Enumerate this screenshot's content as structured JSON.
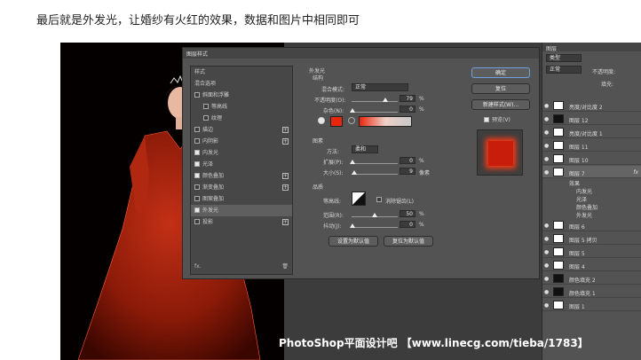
{
  "caption": "最后就是外发光，让婚纱有火红的效果，数据和图片中相同即可",
  "watermark": "PhotoShop平面设计吧 【www.linecg.com/tieba/1783】",
  "dialog": {
    "title": "图层样式",
    "left_items": [
      {
        "label": "样式",
        "has_checkbox": false,
        "checked": false,
        "has_plus": false
      },
      {
        "label": "混合选项",
        "has_checkbox": false,
        "checked": false,
        "has_plus": false
      },
      {
        "label": "斜面和浮雕",
        "has_checkbox": true,
        "checked": false,
        "has_plus": false
      },
      {
        "label": "等高线",
        "has_checkbox": true,
        "checked": false,
        "has_plus": false
      },
      {
        "label": "纹理",
        "has_checkbox": true,
        "checked": false,
        "has_plus": false
      },
      {
        "label": "描边",
        "has_checkbox": true,
        "checked": false,
        "has_plus": true
      },
      {
        "label": "内阴影",
        "has_checkbox": true,
        "checked": false,
        "has_plus": true
      },
      {
        "label": "内发光",
        "has_checkbox": true,
        "checked": true,
        "has_plus": false
      },
      {
        "label": "光泽",
        "has_checkbox": true,
        "checked": true,
        "has_plus": false
      },
      {
        "label": "颜色叠加",
        "has_checkbox": true,
        "checked": true,
        "has_plus": true
      },
      {
        "label": "渐变叠加",
        "has_checkbox": true,
        "checked": false,
        "has_plus": true
      },
      {
        "label": "图案叠加",
        "has_checkbox": true,
        "checked": false,
        "has_plus": false
      },
      {
        "label": "外发光",
        "has_checkbox": true,
        "checked": true,
        "has_plus": false,
        "selected": true
      },
      {
        "label": "投影",
        "has_checkbox": true,
        "checked": false,
        "has_plus": true
      }
    ],
    "footer_fx": "fx.",
    "outer_glow": {
      "header": "外发光",
      "structure": "结构",
      "blend_mode_label": "混合模式:",
      "blend_mode_value": "正常",
      "opacity_label": "不透明度(O):",
      "opacity_value": "79",
      "noise_label": "杂色(N):",
      "noise_value": "0",
      "percent": "%",
      "elements": "图素",
      "method_label": "方法:",
      "method_value": "柔和",
      "spread_label": "扩展(P):",
      "spread_value": "0",
      "size_label": "大小(S):",
      "size_value": "9",
      "pixels": "像素",
      "quality": "品质",
      "contour_label": "等高线:",
      "antialias_label": "消除锯齿(L)",
      "range_label": "范围(R):",
      "range_value": "50",
      "jitter_label": "抖动(J):",
      "jitter_value": "0",
      "set_default": "设置为默认值",
      "reset_default": "复位为默认值",
      "glow_color": "#e8260e"
    },
    "buttons": {
      "ok": "确定",
      "reset": "复位",
      "new_style": "新建样式(W)...",
      "preview": "预览(V)"
    }
  },
  "layers": {
    "tab": "图层",
    "kind": "类型",
    "blend": "正常",
    "opacity": "不透明度:",
    "fill": "填充:",
    "items": [
      {
        "name": "亮度/对比度 2",
        "thumb": "white"
      },
      {
        "name": "图层 12",
        "thumb": "dark"
      },
      {
        "name": "亮度/对比度 1",
        "thumb": "white"
      },
      {
        "name": "图层 11",
        "thumb": "white"
      },
      {
        "name": "图层 10",
        "thumb": "white"
      },
      {
        "name": "图层 7",
        "thumb": "white",
        "fx": "fx"
      },
      {
        "name": "图层 6",
        "thumb": "white"
      },
      {
        "name": "图层 5 拷贝",
        "thumb": "white"
      },
      {
        "name": "图层 5",
        "thumb": "white"
      },
      {
        "name": "图层 4",
        "thumb": "white"
      },
      {
        "name": "颜色填充 2",
        "thumb": "dark"
      },
      {
        "name": "颜色填充 1",
        "thumb": "dark"
      },
      {
        "name": "图层 1",
        "thumb": "white"
      }
    ],
    "effects_label": "效果",
    "effects": [
      "内发光",
      "光泽",
      "颜色叠加",
      "外发光"
    ]
  }
}
